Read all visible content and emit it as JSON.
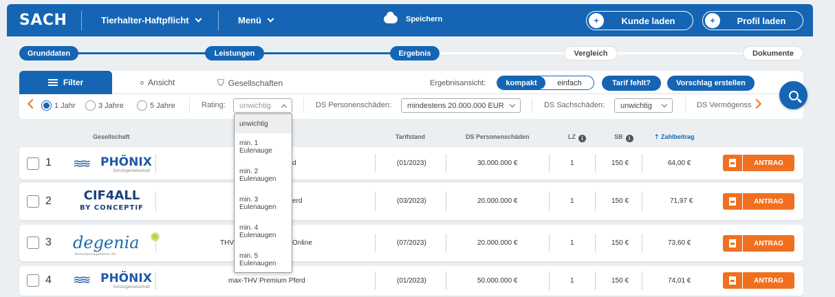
{
  "header": {
    "logo": "SACH",
    "product": "Tierhalter-Haftpflicht",
    "menu": "Menü",
    "save": "Speichern",
    "load_customer": "Kunde laden",
    "load_profile": "Profil laden"
  },
  "stepper": {
    "steps": [
      "Grunddaten",
      "Leistungen",
      "Ergebnis",
      "Vergleich",
      "Dokumente"
    ],
    "completed_count": 3
  },
  "filter": {
    "tab_filter": "Filter",
    "tab_view": "Ansicht",
    "tab_companies": "Gesellschaften",
    "result_view_label": "Ergebnisansicht:",
    "view_compact": "kompakt",
    "view_simple": "einfach",
    "missing_tariff": "Tarif fehlt?",
    "create_proposal": "Vorschlag erstellen",
    "durations": [
      "1 Jahr",
      "3 Jahre",
      "5 Jahre"
    ],
    "selected_duration": "1 Jahr",
    "rating_label": "Rating:",
    "rating_value": "unwichtig",
    "ds_person_label": "DS Personenschäden:",
    "ds_person_value": "mindestens 20.000.000 EUR",
    "ds_sach_label": "DS Sachschäden:",
    "ds_sach_value": "unwichtig",
    "ds_verm_label": "DS Vermögenss"
  },
  "rating_dropdown": {
    "options": [
      {
        "l1": "unwichtig",
        "l2": ""
      },
      {
        "l1": "min. 1",
        "l2": "Eulenauge"
      },
      {
        "l1": "min. 2",
        "l2": "Eulenaugen"
      },
      {
        "l1": "min. 3",
        "l2": "Eulenaugen"
      },
      {
        "l1": "min. 4",
        "l2": "Eulenaugen"
      },
      {
        "l1": "min. 5",
        "l2": "Eulenaugen"
      }
    ]
  },
  "table": {
    "headers": {
      "company": "Gesellschaft",
      "tariff_state": "Tarifstand",
      "ds_person": "DS Personenschäden",
      "lz": "LZ",
      "sb": "SB",
      "premium": "Zahlbeitrag"
    },
    "action_label": "ANTRAG",
    "rows": [
      {
        "num": "1",
        "tariff": "d",
        "state": "(01/2023)",
        "ds": "30.000.000 €",
        "lz": "1",
        "sb": "150 €",
        "premium": "64,00 €",
        "logo_name": "PHÖNIX",
        "logo_sub": "Schutzgemeinschaft"
      },
      {
        "num": "2",
        "tariff": "erd",
        "state": "(03/2023)",
        "ds": "20.000.000 €",
        "lz": "1",
        "sb": "150 €",
        "premium": "71,97 €",
        "logo_name": "CIF4ALL",
        "logo_sub": "BY CONCEPTIF"
      },
      {
        "num": "3",
        "tariff": "THV",
        "tariff_b": "Online",
        "state": "(07/2023)",
        "ds": "20.000.000 €",
        "lz": "1",
        "sb": "150 €",
        "premium": "73,60 €",
        "logo_name": "degenia",
        "logo_sub": "Versicherungsdienst AG"
      },
      {
        "num": "4",
        "tariff": "max-THV Premium Pferd",
        "state": "(01/2023)",
        "ds": "50.000.000 €",
        "lz": "1",
        "sb": "150 €",
        "premium": "74,01 €",
        "logo_name": "PHÖNIX",
        "logo_sub": "Schutzgemeinschaft"
      }
    ]
  },
  "colors": {
    "primary": "#1565b4",
    "accent": "#f07020"
  }
}
